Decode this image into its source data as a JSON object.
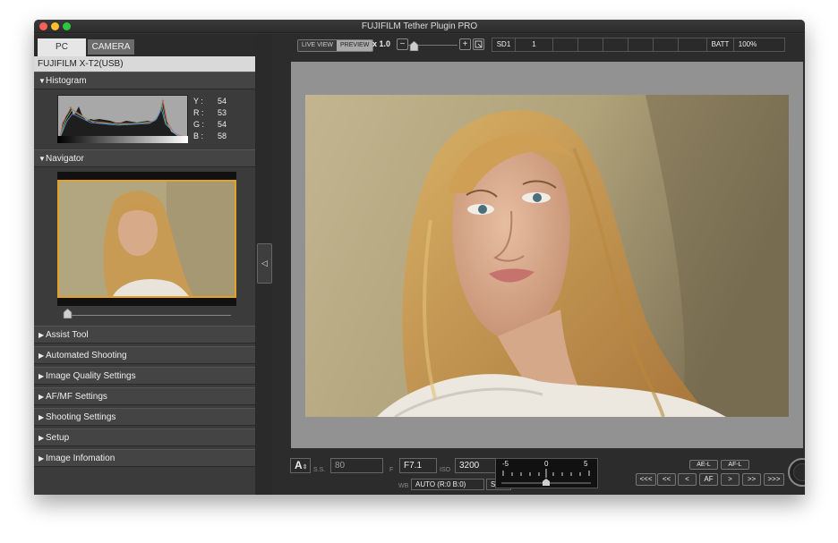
{
  "window": {
    "title": "FUJIFILM Tether Plugin PRO"
  },
  "tabs": [
    {
      "label": "PC"
    },
    {
      "label": "CAMERA"
    }
  ],
  "camera_name": "FUJIFILM X-T2(USB)",
  "histogram": {
    "label": "Histogram",
    "values": [
      {
        "key": "Y :",
        "value": "54"
      },
      {
        "key": "R :",
        "value": "53"
      },
      {
        "key": "G :",
        "value": "54"
      },
      {
        "key": "B :",
        "value": "58"
      }
    ]
  },
  "navigator": {
    "label": "Navigator"
  },
  "sections": [
    "Assist Tool",
    "Automated Shooting",
    "Image Quality Settings",
    "AF/MF Settings",
    "Shooting Settings",
    "Setup",
    "Image Infomation"
  ],
  "toolbar": {
    "live_view": "LIVE VIEW",
    "preview": "PREVIEW",
    "zoom": "x 1.0",
    "minus": "−",
    "plus": "+",
    "slot": "SD1",
    "shots": "1",
    "batt_label": "BATT",
    "batt_value": "100%"
  },
  "bottom": {
    "mode": "A",
    "ss_label": "S.S.",
    "ss_value": "80",
    "f_label": "F",
    "f_value": "F7.1",
    "iso_label": "ISO",
    "iso_value": "3200",
    "wb_label": "WB",
    "wb_value": "AUTO (R:0 B:0)",
    "sft": "SFT",
    "meter": {
      "min": "-5",
      "mid": "0",
      "max": "5"
    },
    "ae_l": "AE-L",
    "af_l": "AF-L",
    "nav_buttons": [
      "<<<",
      "<<",
      "<",
      "AF",
      ">",
      ">>",
      ">>>"
    ]
  },
  "colors": {
    "accent_orange": "#e4a225",
    "panel": "#3b3b3b",
    "section": "#444444"
  }
}
